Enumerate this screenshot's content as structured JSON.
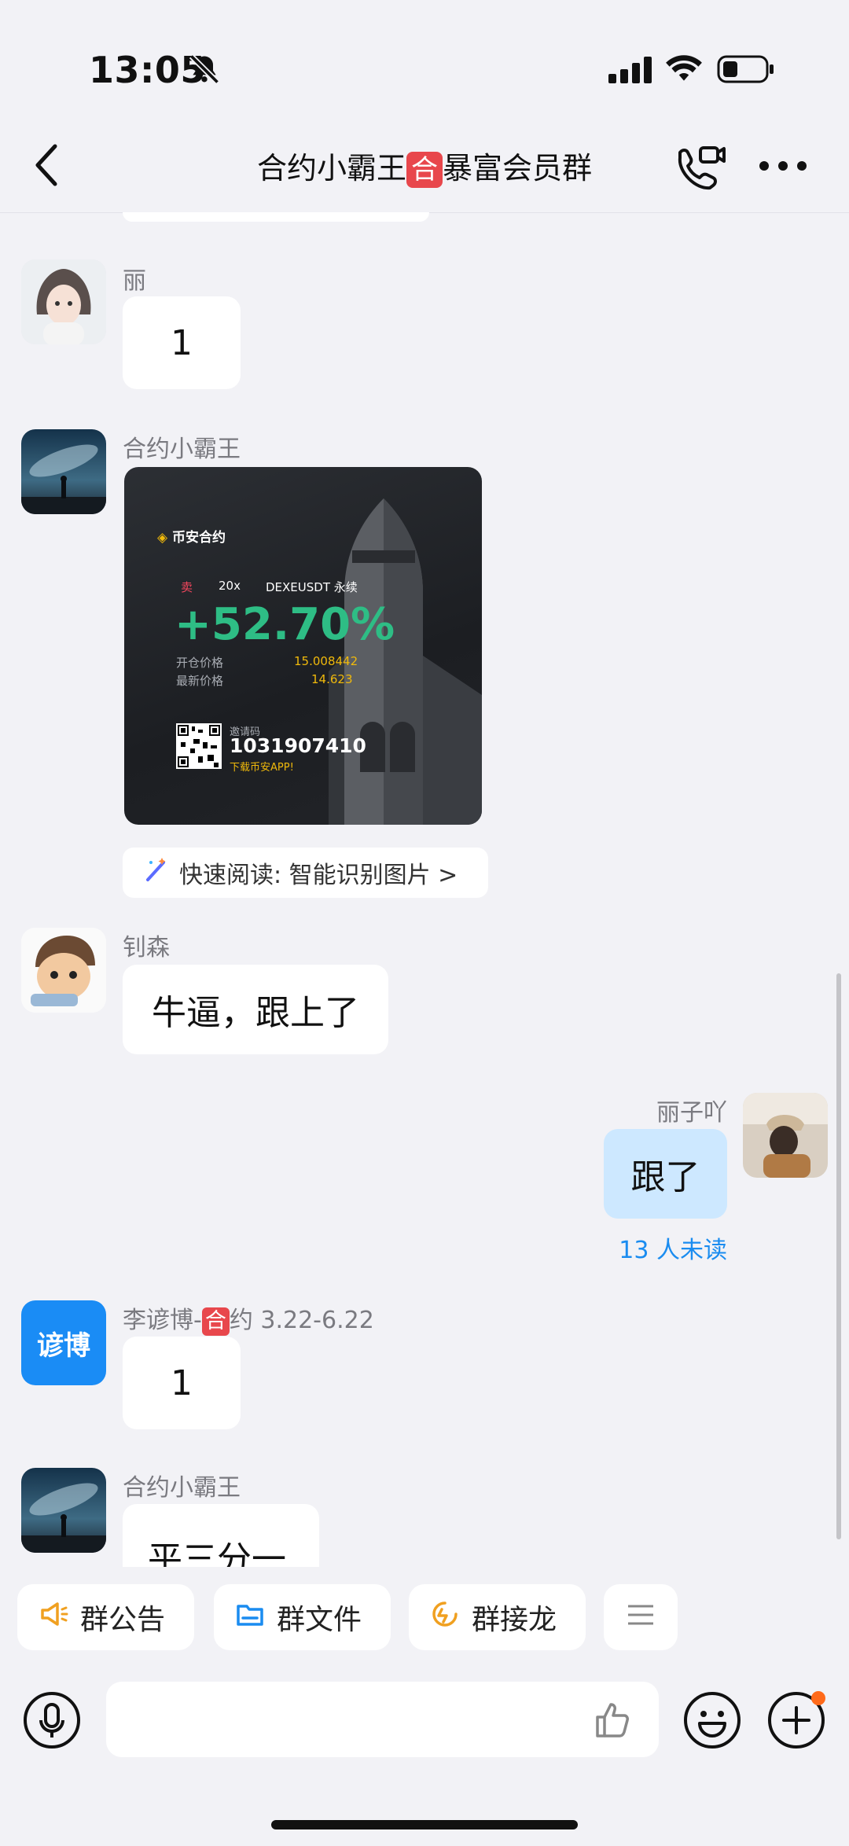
{
  "status_bar": {
    "time": "13:05"
  },
  "header": {
    "title_prefix": "合约小霸王",
    "title_badge": "合",
    "title_suffix": "暴富会员群"
  },
  "messages": [
    {
      "sender": "丽",
      "text": "1"
    },
    {
      "sender": "合约小霸王",
      "image": {
        "brand": "币安合约",
        "side": "卖",
        "leverage": "20x",
        "pair": "DEXEUSDT 永续",
        "pnl": "+52.70%",
        "open_label": "开仓价格",
        "open_value": "15.008442",
        "last_label": "最新价格",
        "last_value": "14.623",
        "invite_label": "邀请码",
        "invite_code": "1031907410",
        "download": "下载币安APP!"
      },
      "quick_read": "快速阅读: 智能识别图片 >"
    },
    {
      "sender": "钊森",
      "text": "牛逼，跟上了"
    },
    {
      "sender": "丽子吖",
      "text": "跟了",
      "mine": true,
      "read_status": "13 人未读"
    },
    {
      "sender_prefix": "李谚博-",
      "sender_badge": "合",
      "sender_suffix": "约 3.22-6.22",
      "avatar_text": "谚博",
      "text": "1"
    },
    {
      "sender": "合约小霸王",
      "text": "平三分一"
    }
  ],
  "quick_actions": [
    {
      "label": "群公告",
      "icon": "megaphone-icon"
    },
    {
      "label": "群文件",
      "icon": "folder-icon"
    },
    {
      "label": "群接龙",
      "icon": "chain-icon"
    }
  ],
  "colors": {
    "accent": "#1677ff",
    "badge": "#e8474c",
    "mine_bubble": "#cde8ff",
    "profit": "#2ebd85",
    "gold": "#f0b90b"
  }
}
